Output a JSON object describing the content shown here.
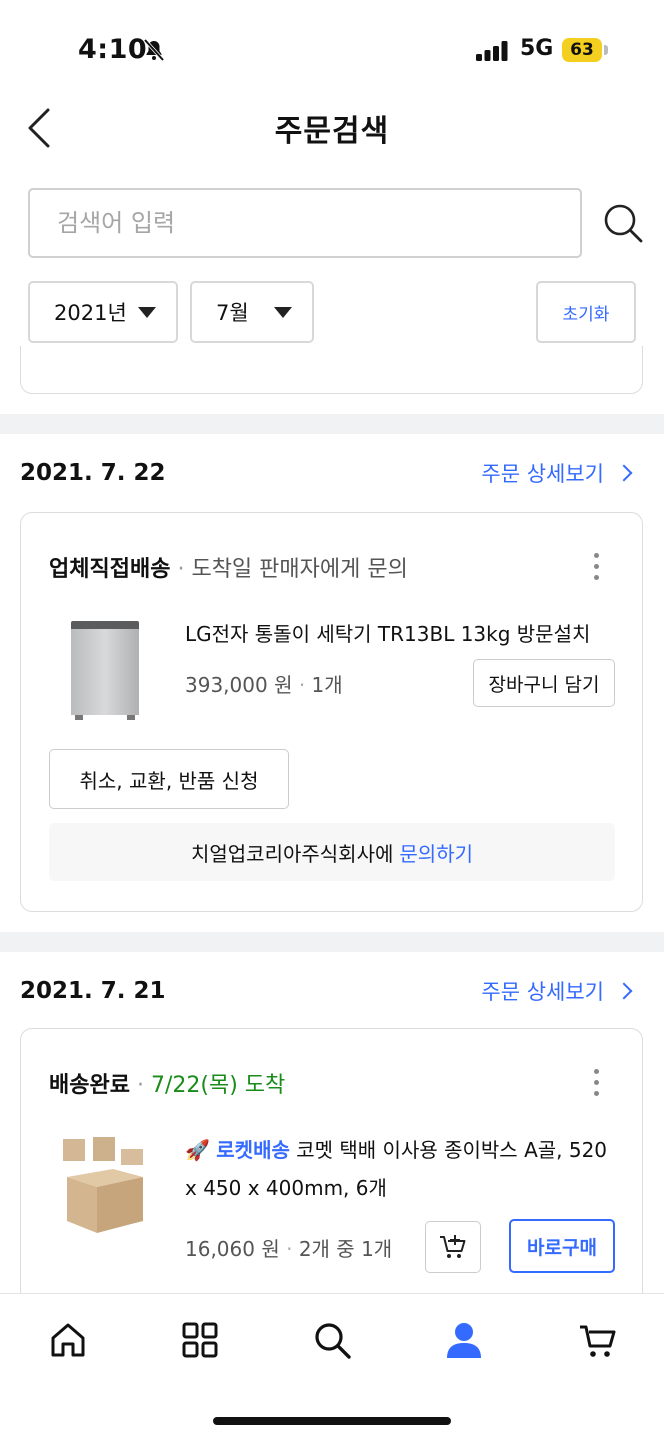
{
  "status_bar": {
    "time": "4:10",
    "network": "5G",
    "battery": "63",
    "icons": [
      "bell-muted-icon",
      "signal-icon"
    ]
  },
  "header": {
    "title": "주문검색",
    "back_icon": "chevron-left-icon"
  },
  "search": {
    "placeholder": "검색어 입력",
    "icon": "search-icon"
  },
  "filters": {
    "year": "2021년",
    "month": "7월",
    "reset_label": "초기화"
  },
  "orders": [
    {
      "date": "2021. 7. 22",
      "detail_label": "주문 상세보기",
      "shipping_status": "업체직접배송",
      "shipping_note": "도착일 판매자에게 문의",
      "product_name": "LG전자 통돌이 세탁기 TR13BL 13kg 방문설치",
      "price": "393,000 원",
      "quantity": "1개",
      "cart_button": "장바구니 담기",
      "action_button": "취소, 교환, 반품 신청",
      "seller_text": "치얼업코리아주식회사에",
      "inquiry_link": "문의하기"
    },
    {
      "date": "2021. 7. 21",
      "detail_label": "주문 상세보기",
      "shipping_status": "배송완료",
      "shipping_note": "7/22(목) 도착",
      "rocket_label": "로켓배송",
      "product_name": "코멧 택배 이사용 종이박스 A골, 520 x 450 x 400mm, 6개",
      "price": "16,060 원",
      "quantity": "2개 중 1개",
      "buy_button": "바로구매"
    }
  ],
  "bottom_nav": [
    "home-icon",
    "category-grid-icon",
    "search-icon",
    "my-account-icon",
    "cart-icon"
  ],
  "colors": {
    "accent_blue": "#346aff",
    "delivered_green": "#1a8c1a",
    "battery_yellow": "#f3cf1f",
    "band_gray": "#f1f2f3"
  }
}
